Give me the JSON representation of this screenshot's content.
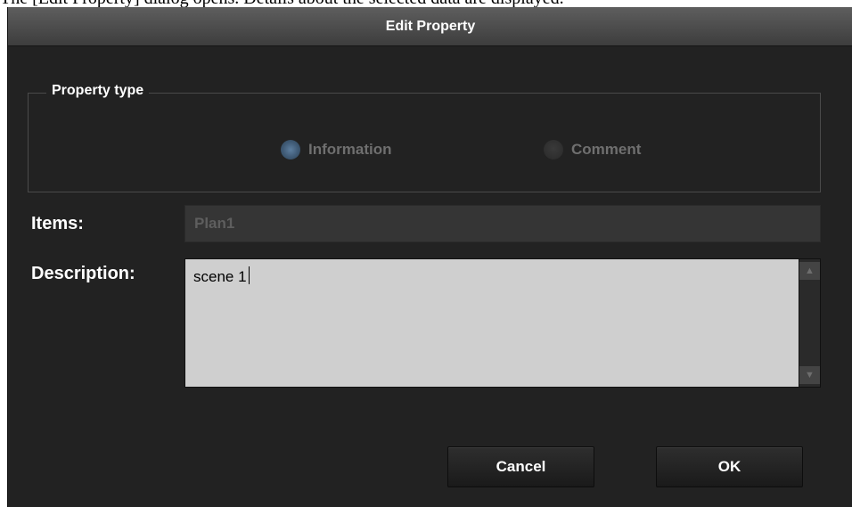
{
  "top_caption": "The [Edit Property] dialog opens. Details about the selected data are displayed.",
  "dialog": {
    "title": "Edit Property",
    "property_type": {
      "legend": "Property type",
      "options": [
        {
          "label": "Information",
          "selected": true
        },
        {
          "label": "Comment",
          "selected": false
        }
      ]
    },
    "items": {
      "label": "Items:",
      "value": "Plan1"
    },
    "description": {
      "label": "Description:",
      "value": "scene 1"
    },
    "buttons": {
      "cancel": "Cancel",
      "ok": "OK"
    }
  },
  "colors": {
    "dialog_bg": "#222222",
    "radio_selected": "#4f6d8c",
    "description_bg": "#cfcfcf"
  }
}
